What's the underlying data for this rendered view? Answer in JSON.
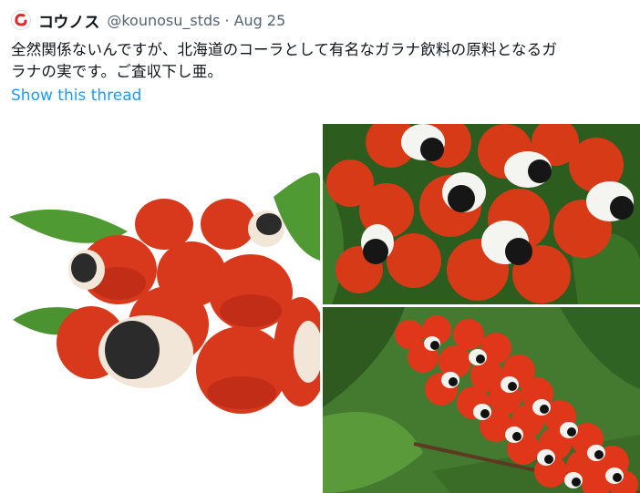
{
  "tweet": {
    "display_name": "コウノス",
    "handle": "@kounosu_stds",
    "separator": "·",
    "date": "Aug 25",
    "text_line1": "全然関係ないんですが、北海道のコーラとして有名なガラナ飲料の原料となるガ",
    "text_line2": "ラナの実です。ご査収下し亜。",
    "show_thread": "Show this thread"
  },
  "colors": {
    "link": "#1d9bf0",
    "muted": "#536471",
    "fruit_red": "#d63a1c",
    "leaf_green": "#3f8f2c"
  },
  "icons": {
    "avatar": "red-hook-logo"
  }
}
